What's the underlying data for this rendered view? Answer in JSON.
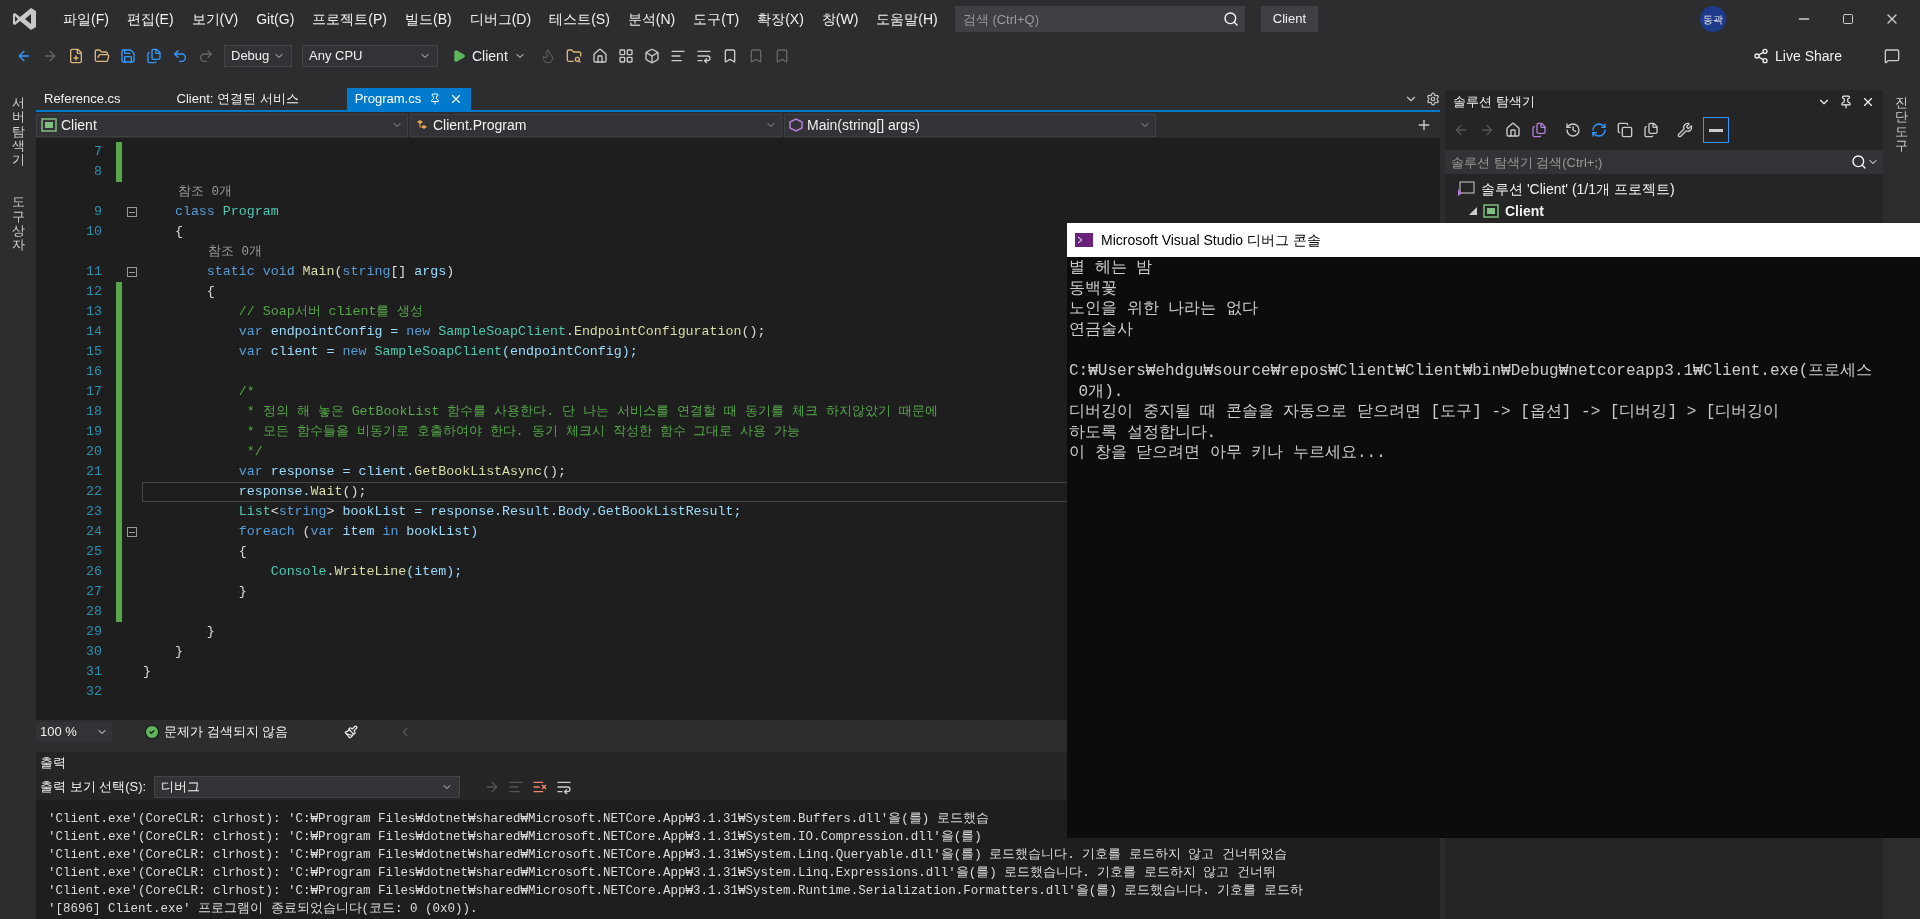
{
  "menu": [
    "파일(F)",
    "편집(E)",
    "보기(V)",
    "Git(G)",
    "프로젝트(P)",
    "빌드(B)",
    "디버그(D)",
    "테스트(S)",
    "분석(N)",
    "도구(T)",
    "확장(X)",
    "창(W)",
    "도움말(H)"
  ],
  "search": {
    "placeholder": "검색 (Ctrl+Q)"
  },
  "solution_name": "Client",
  "user_initials": "동곽",
  "toolbar": {
    "configuration": "Debug",
    "platform": "Any CPU",
    "start": "Client",
    "live_share": "Live Share"
  },
  "side_tabs_left": [
    "서버 탐색기",
    "도구 상자"
  ],
  "side_tabs_right": [
    "진단 도구"
  ],
  "tabs": [
    {
      "label": "Reference.cs",
      "selected": false
    },
    {
      "label": "Client: 연결된 서비스",
      "selected": false
    },
    {
      "label": "Program.cs",
      "selected": true
    }
  ],
  "nav": [
    {
      "label": "Client",
      "kind": "project"
    },
    {
      "label": "Client.Program",
      "kind": "class"
    },
    {
      "label": "Main(string[] args)",
      "kind": "method"
    }
  ],
  "editor": {
    "lines": [
      {
        "kind": "code",
        "number": "7",
        "changed": true,
        "fold": false,
        "current": false
      },
      {
        "kind": "code",
        "number": "8",
        "changed": true,
        "fold": false,
        "current": false
      },
      {
        "kind": "codelens",
        "text": "    참조 0개"
      },
      {
        "kind": "code",
        "number": "9",
        "changed": false,
        "fold": true,
        "current": false,
        "tokens": [
          {
            "text": "    class ",
            "kind": "keyword"
          },
          {
            "text": "Program",
            "kind": "type"
          }
        ]
      },
      {
        "kind": "code",
        "number": "10",
        "changed": false,
        "fold": false,
        "current": false,
        "tokens": [
          {
            "text": "    {",
            "kind": "plain"
          }
        ]
      },
      {
        "kind": "codelens",
        "text": "        참조 0개"
      },
      {
        "kind": "code",
        "number": "11",
        "changed": false,
        "fold": true,
        "current": false,
        "tokens": [
          {
            "text": "        static void ",
            "kind": "keyword"
          },
          {
            "text": "Main",
            "kind": "method"
          },
          {
            "text": "(",
            "kind": "plain"
          },
          {
            "text": "string",
            "kind": "keyword"
          },
          {
            "text": "[] ",
            "kind": "plain"
          },
          {
            "text": "args",
            "kind": "variable"
          },
          {
            "text": ")",
            "kind": "plain"
          }
        ]
      },
      {
        "kind": "code",
        "number": "12",
        "changed": true,
        "fold": false,
        "current": false,
        "tokens": [
          {
            "text": "        {",
            "kind": "plain"
          }
        ]
      },
      {
        "kind": "code",
        "number": "13",
        "changed": true,
        "fold": false,
        "current": false,
        "tokens": [
          {
            "text": "            // Soap서버 client를 생성",
            "kind": "comment"
          }
        ]
      },
      {
        "kind": "code",
        "number": "14",
        "changed": true,
        "fold": false,
        "current": false,
        "tokens": [
          {
            "text": "            var ",
            "kind": "keyword"
          },
          {
            "text": "endpointConfig = ",
            "kind": "variable"
          },
          {
            "text": "new ",
            "kind": "keyword"
          },
          {
            "text": "SampleSoapClient",
            "kind": "type"
          },
          {
            "text": ".",
            "kind": "plain"
          },
          {
            "text": "EndpointConfiguration",
            "kind": "method"
          },
          {
            "text": "();",
            "kind": "plain"
          }
        ]
      },
      {
        "kind": "code",
        "number": "15",
        "changed": true,
        "fold": false,
        "current": false,
        "tokens": [
          {
            "text": "            var ",
            "kind": "keyword"
          },
          {
            "text": "client = ",
            "kind": "variable"
          },
          {
            "text": "new ",
            "kind": "keyword"
          },
          {
            "text": "SampleSoapClient",
            "kind": "type"
          },
          {
            "text": "(endpointConfig);",
            "kind": "variable"
          }
        ]
      },
      {
        "kind": "code",
        "number": "16",
        "changed": true,
        "fold": false,
        "current": false
      },
      {
        "kind": "code",
        "number": "17",
        "changed": true,
        "fold": false,
        "current": false,
        "tokens": [
          {
            "text": "            /*",
            "kind": "comment"
          }
        ]
      },
      {
        "kind": "code",
        "number": "18",
        "changed": true,
        "fold": false,
        "current": false,
        "tokens": [
          {
            "text": "             * 정의 해 놓은 GetBookList 함수를 사용한다. 단 나는 서비스를 연결할 때 동기를 체크 하지않았기 때문에",
            "kind": "comment"
          }
        ]
      },
      {
        "kind": "code",
        "number": "19",
        "changed": true,
        "fold": false,
        "current": false,
        "tokens": [
          {
            "text": "             * 모든 함수들을 비동기로 호출하여야 한다. 동기 체크시 작성한 함수 그대로 사용 가능",
            "kind": "comment"
          }
        ]
      },
      {
        "kind": "code",
        "number": "20",
        "changed": true,
        "fold": false,
        "current": false,
        "tokens": [
          {
            "text": "             */",
            "kind": "comment"
          }
        ]
      },
      {
        "kind": "code",
        "number": "21",
        "changed": true,
        "fold": false,
        "current": false,
        "tokens": [
          {
            "text": "            var ",
            "kind": "keyword"
          },
          {
            "text": "response = client.",
            "kind": "variable"
          },
          {
            "text": "GetBookListAsync",
            "kind": "method"
          },
          {
            "text": "();",
            "kind": "plain"
          }
        ]
      },
      {
        "kind": "code",
        "number": "22",
        "changed": true,
        "fold": false,
        "current": true,
        "tokens": [
          {
            "text": "            response.",
            "kind": "variable"
          },
          {
            "text": "Wait",
            "kind": "method"
          },
          {
            "text": "();",
            "kind": "plain"
          }
        ]
      },
      {
        "kind": "code",
        "number": "23",
        "changed": true,
        "fold": false,
        "current": false,
        "tokens": [
          {
            "text": "            List",
            "kind": "type"
          },
          {
            "text": "<",
            "kind": "plain"
          },
          {
            "text": "string",
            "kind": "keyword"
          },
          {
            "text": "> ",
            "kind": "plain"
          },
          {
            "text": "bookList = response.Result.Body.GetBookListResult;",
            "kind": "variable"
          }
        ]
      },
      {
        "kind": "code",
        "number": "24",
        "changed": true,
        "fold": true,
        "current": false,
        "tokens": [
          {
            "text": "            foreach ",
            "kind": "keyword"
          },
          {
            "text": "(",
            "kind": "plain"
          },
          {
            "text": "var ",
            "kind": "keyword"
          },
          {
            "text": "item ",
            "kind": "variable"
          },
          {
            "text": "in ",
            "kind": "keyword"
          },
          {
            "text": "bookList)",
            "kind": "variable"
          }
        ]
      },
      {
        "kind": "code",
        "number": "25",
        "changed": true,
        "fold": false,
        "current": false,
        "tokens": [
          {
            "text": "            {",
            "kind": "plain"
          }
        ]
      },
      {
        "kind": "code",
        "number": "26",
        "changed": true,
        "fold": false,
        "current": false,
        "tokens": [
          {
            "text": "                Console",
            "kind": "type"
          },
          {
            "text": ".",
            "kind": "plain"
          },
          {
            "text": "WriteLine",
            "kind": "method"
          },
          {
            "text": "(item);",
            "kind": "variable"
          }
        ]
      },
      {
        "kind": "code",
        "number": "27",
        "changed": true,
        "fold": false,
        "current": false,
        "tokens": [
          {
            "text": "            }",
            "kind": "plain"
          }
        ]
      },
      {
        "kind": "code",
        "number": "28",
        "changed": true,
        "fold": false,
        "current": false
      },
      {
        "kind": "code",
        "number": "29",
        "changed": false,
        "fold": false,
        "current": false,
        "tokens": [
          {
            "text": "        }",
            "kind": "plain"
          }
        ]
      },
      {
        "kind": "code",
        "number": "30",
        "changed": false,
        "fold": false,
        "current": false,
        "tokens": [
          {
            "text": "    }",
            "kind": "plain"
          }
        ]
      },
      {
        "kind": "code",
        "number": "31",
        "changed": false,
        "fold": false,
        "current": false,
        "tokens": [
          {
            "text": "}",
            "kind": "plain"
          }
        ]
      },
      {
        "kind": "code",
        "number": "32",
        "changed": false,
        "fold": false,
        "current": false
      }
    ]
  },
  "editor_status": {
    "zoom": "100 %",
    "issues": "문제가 검색되지 않음"
  },
  "output": {
    "title": "출력",
    "source_label": "출력 보기 선택(S):",
    "source": "디버그",
    "lines": [
      "'Client.exe'(CoreCLR: clrhost): 'C:₩Program Files₩dotnet₩shared₩Microsoft.NETCore.App₩3.1.31₩System.Buffers.dll'을(를) 로드했습",
      "'Client.exe'(CoreCLR: clrhost): 'C:₩Program Files₩dotnet₩shared₩Microsoft.NETCore.App₩3.1.31₩System.IO.Compression.dll'을(를)",
      "'Client.exe'(CoreCLR: clrhost): 'C:₩Program Files₩dotnet₩shared₩Microsoft.NETCore.App₩3.1.31₩System.Linq.Queryable.dll'을(를) 로드했습니다. 기호를 로드하지 않고 건너뛰었습",
      "'Client.exe'(CoreCLR: clrhost): 'C:₩Program Files₩dotnet₩shared₩Microsoft.NETCore.App₩3.1.31₩System.Linq.Expressions.dll'을(를) 로드했습니다. 기호를 로드하지 않고 건너뛰",
      "'Client.exe'(CoreCLR: clrhost): 'C:₩Program Files₩dotnet₩shared₩Microsoft.NETCore.App₩3.1.31₩System.Runtime.Serialization.Formatters.dll'을(를) 로드했습니다. 기호를 로드하",
      "'[8696] Client.exe' 프로그램이 종료되었습니다(코드: 0 (0x0))."
    ]
  },
  "solution_explorer": {
    "title": "솔루션 탐색기",
    "search_placeholder": "솔루션 탐색기 검색(Ctrl+;)",
    "tree": [
      {
        "label": "솔루션 'Client' (1/1개 프로젝트)",
        "kind": "solution",
        "children": [
          {
            "label": "Client",
            "kind": "project",
            "expanded": true
          }
        ]
      }
    ]
  },
  "console": {
    "title": "Microsoft Visual Studio 디버그 콘솔",
    "program_lines": [
      "별 헤는 밤",
      "동백꽃",
      "노인을 위한 나라는 없다",
      "연금술사"
    ],
    "exit_lines": [
      "C:₩Users₩ehdgu₩source₩repos₩Client₩Client₩bin₩Debug₩netcoreapp3.1₩Client.exe(프로세스",
      " 0개).",
      "디버깅이 중지될 때 콘솔을 자동으로 닫으려면 [도구] -> [옵션] -> [디버깅] > [디버깅이",
      "하도록 설정합니다.",
      "이 창을 닫으려면 아무 키나 누르세요..."
    ]
  }
}
